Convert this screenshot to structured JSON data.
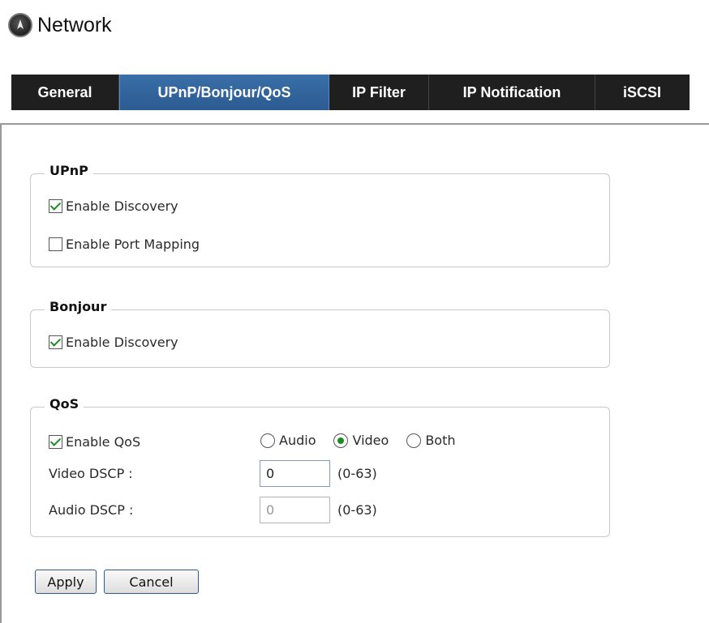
{
  "header": {
    "title": "Network",
    "icon": "network-globe-icon"
  },
  "tabs": [
    {
      "label": "General",
      "active": false
    },
    {
      "label": "UPnP/Bonjour/QoS",
      "active": true
    },
    {
      "label": "IP Filter",
      "active": false
    },
    {
      "label": "IP Notification",
      "active": false
    },
    {
      "label": "iSCSI",
      "active": false
    }
  ],
  "upnp": {
    "legend": "UPnP",
    "enable_discovery": {
      "label": "Enable Discovery",
      "checked": true
    },
    "enable_port_mapping": {
      "label": "Enable Port Mapping",
      "checked": false
    }
  },
  "bonjour": {
    "legend": "Bonjour",
    "enable_discovery": {
      "label": "Enable Discovery",
      "checked": true
    }
  },
  "qos": {
    "legend": "QoS",
    "enable_qos": {
      "label": "Enable QoS",
      "checked": true
    },
    "mode_options": [
      {
        "label": "Audio",
        "selected": false
      },
      {
        "label": "Video",
        "selected": true
      },
      {
        "label": "Both",
        "selected": false
      }
    ],
    "video_dscp": {
      "label": "Video DSCP :",
      "value": "0",
      "range": "(0-63)",
      "disabled": false
    },
    "audio_dscp": {
      "label": "Audio DSCP :",
      "value": "0",
      "range": "(0-63)",
      "disabled": true
    }
  },
  "buttons": {
    "apply": "Apply",
    "cancel": "Cancel"
  },
  "colors": {
    "tab_bg": "#1f1f1f",
    "tab_active": "#2b5b91",
    "check_mark": "#1e8c23"
  }
}
